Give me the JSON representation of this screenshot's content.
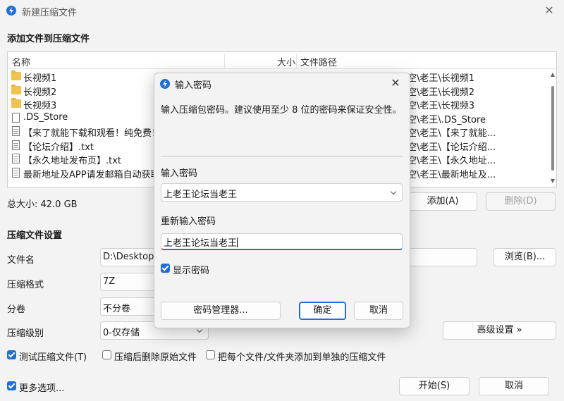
{
  "window": {
    "title": "新建压缩文件",
    "close_glyph": "✕"
  },
  "add_section": {
    "title": "添加文件到压缩文件"
  },
  "filelist": {
    "columns": {
      "name": "名称",
      "size": "大小",
      "path": "文件路径"
    },
    "rows": [
      {
        "name": "长视频1",
        "icon": "folder-icon",
        "path": "空\\老王\\长视频1"
      },
      {
        "name": "长视频2",
        "icon": "folder-icon",
        "path": "空\\老王\\长视频2"
      },
      {
        "name": "长视频3",
        "icon": "folder-icon",
        "path": "空\\老王\\长视频3"
      },
      {
        "name": ".DS_Store",
        "icon": "file-icon",
        "path": "空\\老王\\.DS_Store"
      },
      {
        "name": "【来了就能下载和观看！纯免费！",
        "icon": "text-file-icon",
        "path": "空\\老王\\【来了就能..."
      },
      {
        "name": "【论坛介绍】.txt",
        "icon": "text-file-icon",
        "path": "空\\老王\\【论坛介绍..."
      },
      {
        "name": "【永久地址发布页】.txt",
        "icon": "text-file-icon",
        "path": "空\\老王\\【永久地址..."
      },
      {
        "name": "最新地址及APP请发邮箱自动获取",
        "icon": "text-file-icon",
        "path": "空\\老王\\最新地址及..."
      }
    ]
  },
  "total_size": "总大小: 42.0 GB",
  "buttons": {
    "add": "添加(A)",
    "delete": "删除(D)",
    "browse": "浏览(B)...",
    "advanced": "高级设置 »",
    "start": "开始(S)",
    "cancel": "取消"
  },
  "settings": {
    "title": "压缩文件设置",
    "filename_label": "文件名",
    "filename_value": "D:\\Desktop\\",
    "format_label": "压缩格式",
    "format_value": "7Z",
    "split_label": "分卷",
    "split_value": "不分卷",
    "level_label": "压缩级别",
    "level_value": "0-仅存储"
  },
  "checks": {
    "test": {
      "label": "测试压缩文件(T)",
      "checked": true
    },
    "delete_src": {
      "label": "压缩后删除原始文件",
      "checked": false
    },
    "separate": {
      "label": "把每个文件/文件夹添加到单独的压缩文件",
      "checked": false
    },
    "more": {
      "label": "更多选项...",
      "checked": true
    }
  },
  "dialog": {
    "title": "输入密码",
    "close_glyph": "✕",
    "hint": "输入压缩包密码。建议使用至少 8 位的密码来保证安全性。",
    "password_label": "输入密码",
    "password_value": "上老王论坛当老王",
    "confirm_label": "重新输入密码",
    "confirm_value": "上老王论坛当老王",
    "show_password": {
      "label": "显示密码",
      "checked": true
    },
    "manager_button": "密码管理器...",
    "ok_button": "确定",
    "cancel_button": "取消"
  },
  "colors": {
    "accent": "#1f6fd6",
    "background": "#f3f3f3"
  }
}
